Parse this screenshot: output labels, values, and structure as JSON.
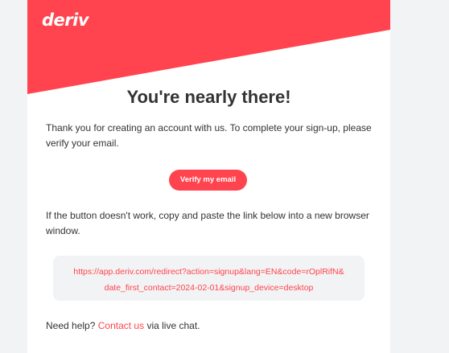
{
  "brand": {
    "logo_text": "deriv",
    "accent_color": "#ff444f"
  },
  "email": {
    "heading": "You're nearly there!",
    "intro": "Thank you for creating an account with us. To complete your sign-up, please verify your email.",
    "verify_button_label": "Verify my email",
    "fallback_text": "If the button doesn't work, copy and paste the link below into a new browser window.",
    "link_line_1": "https://app.deriv.com/redirect?action=signup&lang=EN&code=rOplRifN&",
    "link_line_2": "date_first_contact=2024-02-01&signup_device=desktop",
    "help_prefix": "Need help?",
    "help_link_label": "Contact us",
    "help_suffix": "via live chat."
  }
}
